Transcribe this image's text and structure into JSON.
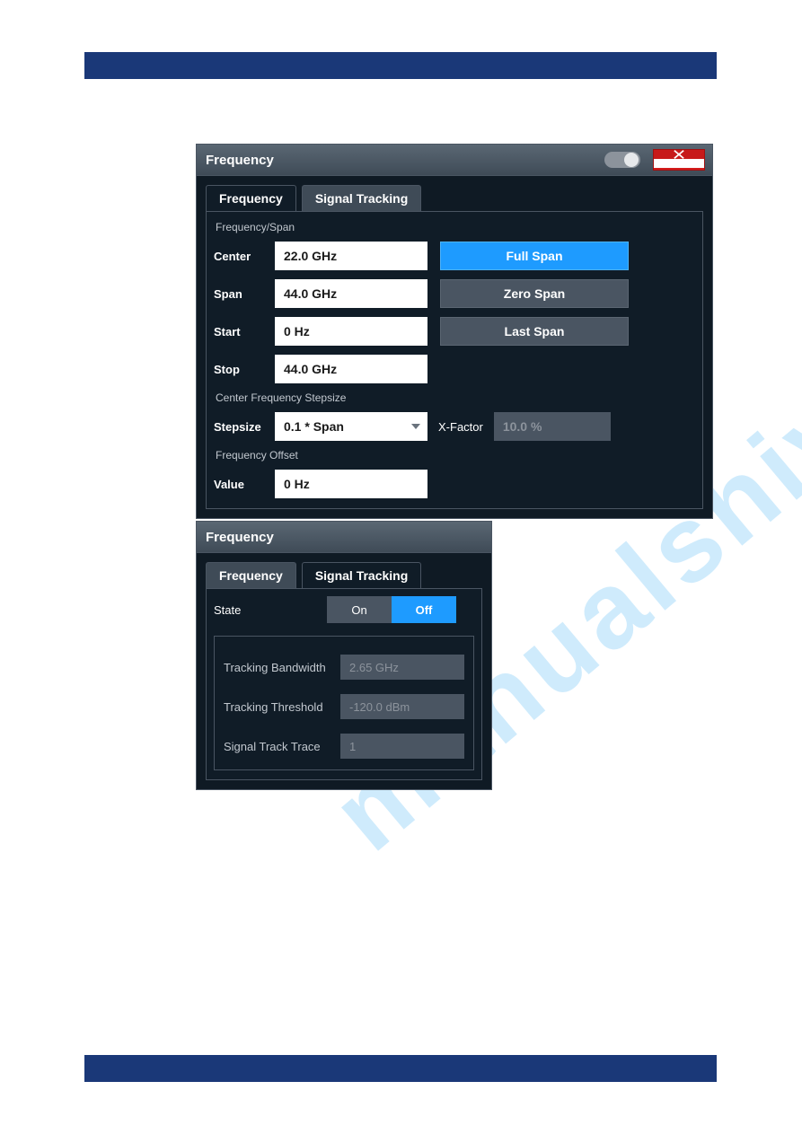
{
  "page": {
    "watermark": "manualshive.com"
  },
  "dlg1": {
    "title": "Frequency",
    "tabs": {
      "frequency": "Frequency",
      "signal_tracking": "Signal Tracking"
    },
    "section_freq_span": "Frequency/Span",
    "labels": {
      "center": "Center",
      "span": "Span",
      "start": "Start",
      "stop": "Stop"
    },
    "values": {
      "center": "22.0 GHz",
      "span": "44.0 GHz",
      "start": "0 Hz",
      "stop": "44.0 GHz"
    },
    "buttons": {
      "full_span": "Full Span",
      "zero_span": "Zero Span",
      "last_span": "Last Span"
    },
    "section_stepsize": "Center Frequency Stepsize",
    "stepsize_label": "Stepsize",
    "stepsize_value": "0.1 * Span",
    "xfactor_label": "X-Factor",
    "xfactor_value": "10.0 %",
    "section_offset": "Frequency Offset",
    "offset_label": "Value",
    "offset_value": "0 Hz"
  },
  "dlg2": {
    "title": "Frequency",
    "tabs": {
      "frequency": "Frequency",
      "signal_tracking": "Signal Tracking"
    },
    "state_label": "State",
    "on": "On",
    "off": "Off",
    "rows": {
      "tracking_bw_label": "Tracking Bandwidth",
      "tracking_bw_value": "2.65 GHz",
      "tracking_th_label": "Tracking Threshold",
      "tracking_th_value": "-120.0 dBm",
      "track_trace_label": "Signal Track Trace",
      "track_trace_value": "1"
    }
  }
}
